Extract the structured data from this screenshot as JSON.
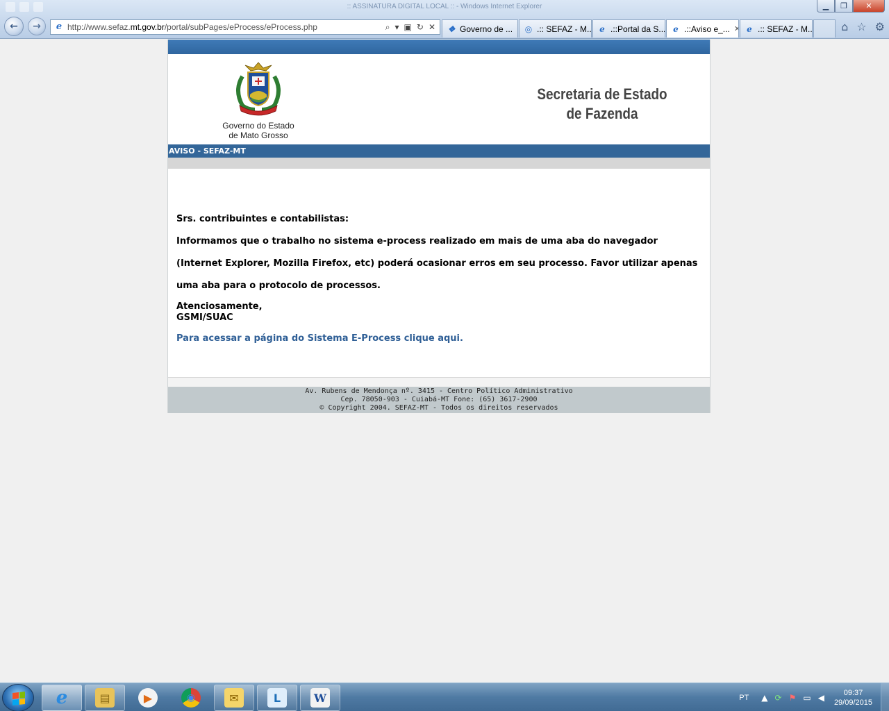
{
  "browser": {
    "window_title": ":: ASSINATURA DIGITAL LOCAL :: - Windows Internet Explorer",
    "address_prefix": "http://www.sefaz.",
    "address_domain": "mt.gov.br",
    "address_path": "/portal/subPages/eProcess/eProcess.php",
    "tabs": [
      {
        "label": "Governo de ..."
      },
      {
        "label": ".:: SEFAZ - M..."
      },
      {
        "label": ".::Portal da S..."
      },
      {
        "label": ".::Aviso e_...",
        "active": true
      },
      {
        "label": ".:: SEFAZ - M..."
      }
    ]
  },
  "header": {
    "gov_line1": "Governo do Estado",
    "gov_line2": "de Mato Grosso",
    "sec_line1": "Secretaria de Estado",
    "sec_line2": "de Fazenda"
  },
  "section_title": "AVISO - SEFAZ-MT",
  "notice": {
    "greeting": "Srs. contribuintes e contabilistas:",
    "body": "Informamos que o trabalho no sistema e-process realizado em mais de uma aba do navegador (Internet Explorer, Mozilla Firefox, etc) poderá ocasionar erros em seu processo. Favor utilizar apenas uma aba para o protocolo de processos.",
    "closing": "Atenciosamente,",
    "signature": "GSMI/SUAC",
    "link_text": "Para acessar a página do Sistema E-Process clique aqui."
  },
  "footer": {
    "line1": "Av. Rubens de Mendonça nº. 3415 - Centro Político Administrativo",
    "line2": "Cep. 78050-903 - Cuiabá-MT Fone: (65) 3617-2900",
    "line3": "© Copyright 2004. SEFAZ-MT - Todos os direitos reservados"
  },
  "taskbar": {
    "language": "PT",
    "time": "09:37",
    "date": "29/09/2015",
    "apps": [
      {
        "name": "internet-explorer",
        "glyph": "e"
      },
      {
        "name": "file-explorer",
        "glyph": "▤"
      },
      {
        "name": "media-player",
        "glyph": "▶"
      },
      {
        "name": "chrome",
        "glyph": "◉"
      },
      {
        "name": "outlook",
        "glyph": "✉"
      },
      {
        "name": "lync",
        "glyph": "L"
      },
      {
        "name": "word",
        "glyph": "W"
      }
    ]
  },
  "colors": {
    "section_bar": "#336699",
    "link": "#2f5f96",
    "footer_bg": "#c1c9cc"
  }
}
